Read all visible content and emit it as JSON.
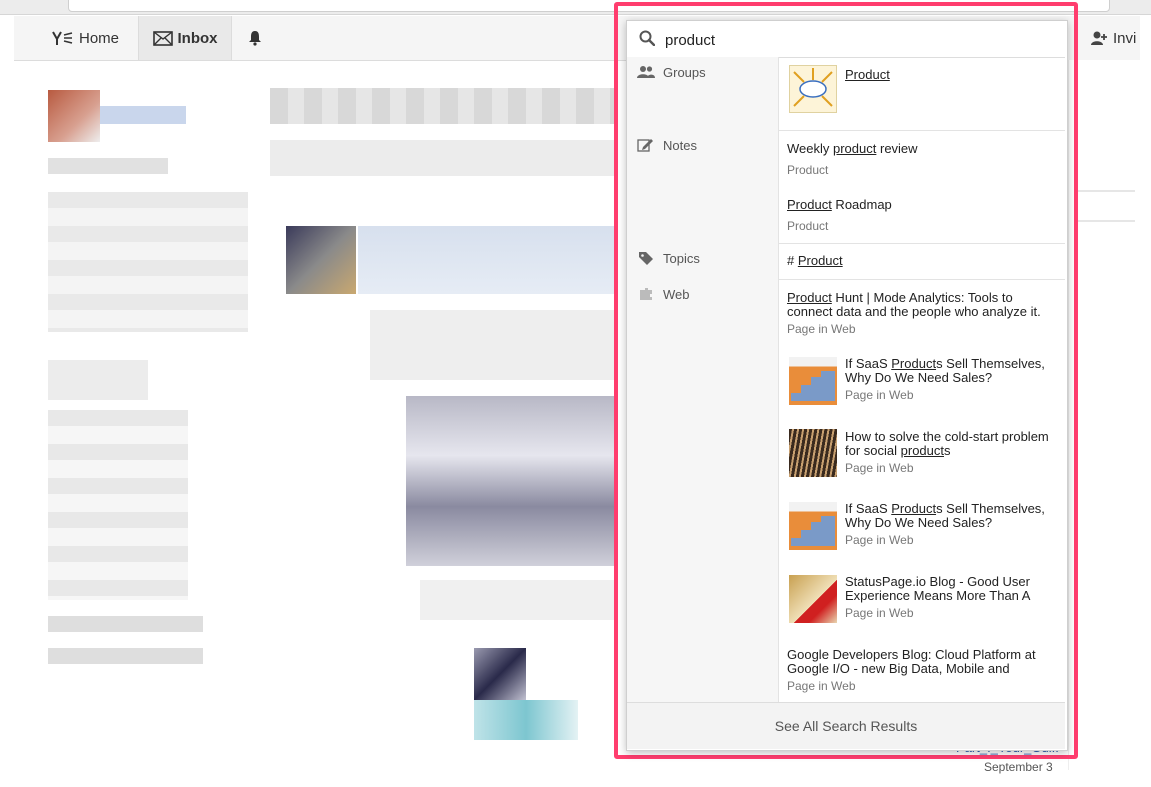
{
  "header": {
    "home_label": "Home",
    "inbox_label": "Inbox",
    "invite_label": "Invi"
  },
  "search": {
    "query": "product",
    "see_all_label": "See All Search Results",
    "groups": {
      "label": "Groups",
      "items": [
        {
          "title": "Product"
        }
      ]
    },
    "notes": {
      "label": "Notes",
      "items": [
        {
          "title_pre": "Weekly ",
          "title_match": "product",
          "title_post": " review",
          "sub": "Product"
        },
        {
          "title_pre": "",
          "title_match": "Product",
          "title_post": " Roadmap",
          "sub": "Product"
        }
      ]
    },
    "topics": {
      "label": "Topics",
      "items": [
        {
          "prefix": "# ",
          "title": "Product"
        }
      ]
    },
    "web": {
      "label": "Web",
      "items": [
        {
          "line1_match": "Product",
          "line1_post": " Hunt | Mode Analytics: Tools to",
          "line2": "connect data and the people who analyze it.",
          "sub": "Page in Web"
        },
        {
          "line1_pre": "If SaaS ",
          "line1_match": "Product",
          "line1_post": "s Sell Themselves,",
          "line2": "Why Do We Need Sales?",
          "sub": "Page in Web"
        },
        {
          "line1": "How to solve the cold-start problem",
          "line2_pre": "for social ",
          "line2_match": "product",
          "line2_post": "s",
          "sub": "Page in Web"
        },
        {
          "line1_pre": "If SaaS ",
          "line1_match": "Product",
          "line1_post": "s Sell Themselves,",
          "line2": "Why Do We Need Sales?",
          "sub": "Page in Web"
        },
        {
          "line1": "StatusPage.io Blog - Good User",
          "line2": "Experience Means More Than A",
          "sub": "Page in Web"
        },
        {
          "line1": "Google Developers Blog: Cloud Platform at",
          "line2": "Google I/O - new Big Data, Mobile and",
          "sub": "Page in Web"
        }
      ]
    }
  },
  "background": {
    "peek_link": "Part_I_Your_Gui..",
    "peek_date": "September 3"
  },
  "colors": {
    "highlight": "#ff3d6e"
  }
}
